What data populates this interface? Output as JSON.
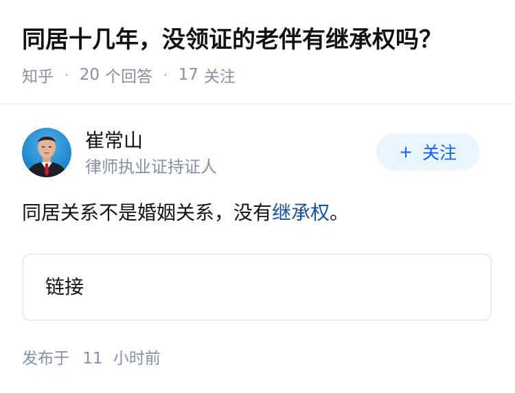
{
  "question": {
    "title": "同居十几年，没领证的老伴有继承权吗？",
    "source": "知乎",
    "separator": "·",
    "answers_count": "20",
    "answers_label": "个回答",
    "follows_count": "17",
    "follows_label": "关注"
  },
  "author": {
    "name": "崔常山",
    "bio": "律师执业证持证人",
    "follow_button_plus": "+",
    "follow_button_label": "关注",
    "avatar_icon": "person-avatar-icon"
  },
  "answer": {
    "text_before": "同居关系不是婚姻关系，没有",
    "link_text": "继承权",
    "text_after": "。"
  },
  "link_card": {
    "label": "链接"
  },
  "publish": {
    "prefix": "发布于",
    "count": "11",
    "unit": "小时前"
  },
  "colors": {
    "accent": "#0066ff",
    "link": "#175199",
    "meta_gray": "#8590a6",
    "follow_bg": "#ebf5fd",
    "divider": "#ebebeb"
  }
}
